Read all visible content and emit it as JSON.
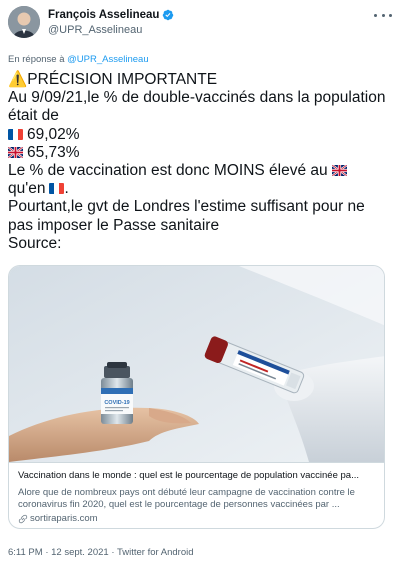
{
  "author": {
    "name": "François Asselineau",
    "handle": "@UPR_Asselineau",
    "avatar_icon": "person-avatar",
    "verified_icon": "verified-badge-icon"
  },
  "reply": {
    "prefix": "En réponse à",
    "mention": "@UPR_Asselineau"
  },
  "tweet": {
    "lines": {
      "l1": "⚠️PRÉCISION IMPORTANTE",
      "l2": "Au 9/09/21,le % de double-vaccinés dans la population",
      "l3": "était de",
      "fr_value": "69,02%",
      "uk_value": "65,73%",
      "l6": "Le % de vaccination est donc MOINS élevé au",
      "l7": "qu'en",
      "l7_end": ".",
      "l8": "Pourtant,le gvt de Londres l'estime suffisant pour ne",
      "l9": "pas imposer le Passe sanitaire",
      "l10": "Source:"
    },
    "flags": [
      "flag-france",
      "flag-uk"
    ]
  },
  "card": {
    "image_label": "COVID-19",
    "title": "Vaccination dans le monde : quel est le pourcentage de population vaccinée pa...",
    "description": "Alore que de nombreux pays ont débuté leur campagne de vaccination contre le coronavirus fin 2020, quel est le pourcentage de personnes vaccinées par ...",
    "domain": "sortiraparis.com"
  },
  "footer": {
    "text": "6:11 PM · 12 sept. 2021 · Twitter for Android"
  },
  "colors": {
    "link": "#1d9bf0",
    "secondary_text": "#536471",
    "border": "#cfd9de"
  }
}
